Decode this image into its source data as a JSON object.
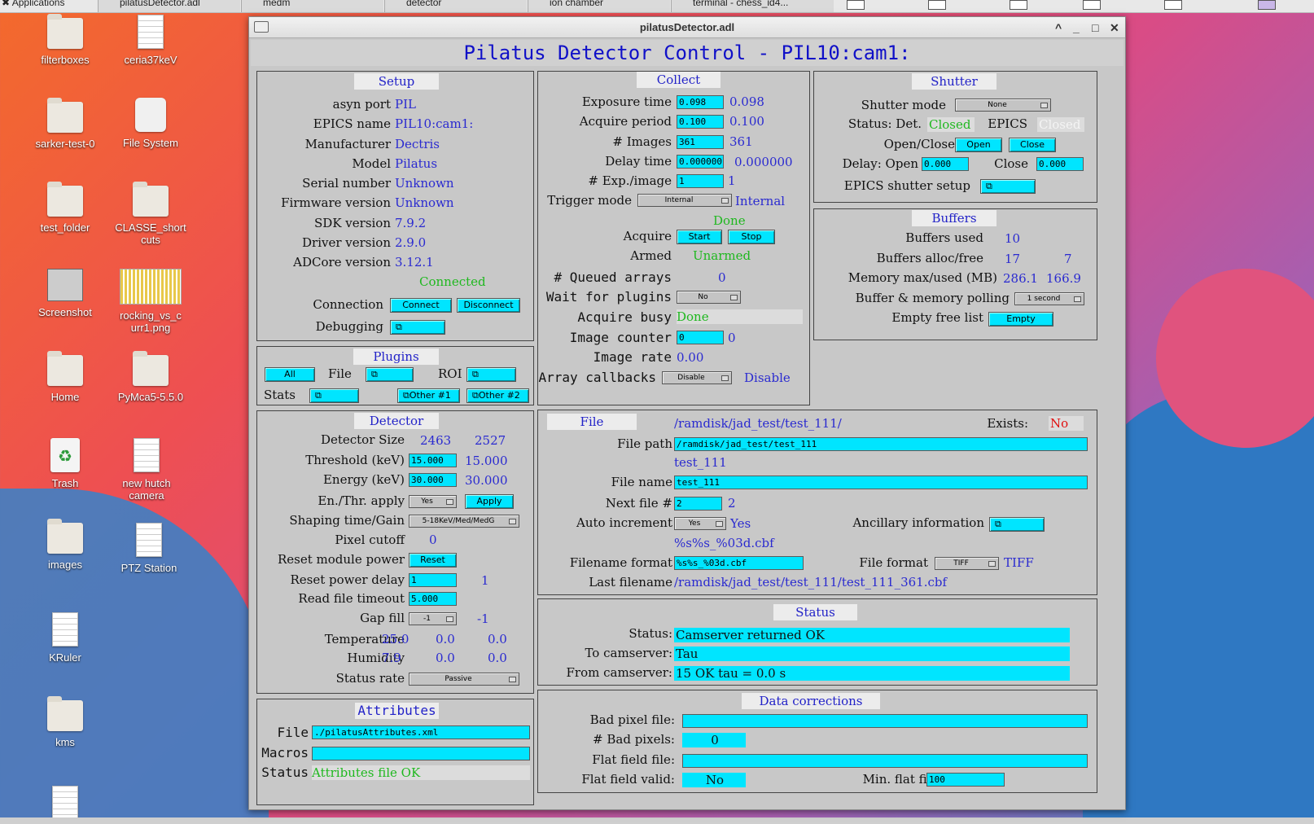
{
  "taskbar": {
    "apps": "Applications",
    "tabs": [
      "pilatusDetector.adl",
      "medm",
      "detector",
      "ion chamber",
      "terminal - chess_id4..."
    ]
  },
  "desktop": {
    "icons": [
      "filterboxes",
      "ceria37keV",
      "sarker-test-0",
      "File System",
      "test_folder",
      "CLASSE_short cuts",
      "Screenshot",
      "rocking_vs_c urr1.png",
      "Home",
      "PyMca5-5.5.0",
      "Trash",
      "new hutch camera",
      "images",
      "PTZ Station",
      "KRuler",
      "kms"
    ]
  },
  "window": {
    "title": "pilatusDetector.adl",
    "controls": [
      "^",
      "_",
      "□",
      "✕"
    ]
  },
  "main_title": "Pilatus Detector Control - PIL10:cam1:",
  "setup": {
    "title": "Setup",
    "rows": [
      {
        "label": "asyn port",
        "value": "PIL"
      },
      {
        "label": "EPICS name",
        "value": "PIL10:cam1:"
      },
      {
        "label": "Manufacturer",
        "value": "Dectris"
      },
      {
        "label": "Model",
        "value": "Pilatus"
      },
      {
        "label": "Serial number",
        "value": "Unknown"
      },
      {
        "label": "Firmware version",
        "value": "Unknown"
      },
      {
        "label": "SDK version",
        "value": "7.9.2"
      },
      {
        "label": "Driver version",
        "value": "2.9.0"
      },
      {
        "label": "ADCore version",
        "value": "3.12.1"
      }
    ],
    "connected": "Connected",
    "connection_label": "Connection",
    "connect": "Connect",
    "disconnect": "Disconnect",
    "debugging_label": "Debugging"
  },
  "plugins": {
    "title": "Plugins",
    "all": "All",
    "file": "File",
    "roi": "ROI",
    "stats": "Stats",
    "other1": "Other #1",
    "other2": "Other #2"
  },
  "detector": {
    "title": "Detector",
    "size_label": "Detector Size",
    "size_x": "2463",
    "size_y": "2527",
    "threshold_label": "Threshold (keV)",
    "threshold_in": "15.000",
    "threshold_rbv": "15.000",
    "energy_label": "Energy (keV)",
    "energy_in": "30.000",
    "energy_rbv": "30.000",
    "apply_label": "En./Thr. apply",
    "apply_menu": "Yes",
    "apply_btn": "Apply",
    "shaping_label": "Shaping time/Gain",
    "shaping_menu": "5-18KeV/Med/MedG",
    "cutoff_label": "Pixel cutoff",
    "cutoff": "0",
    "reset_label": "Reset module power",
    "reset_btn": "Reset",
    "delay_label": "Reset power delay",
    "delay_in": "1",
    "delay_rbv": "1",
    "timeout_label": "Read file timeout",
    "timeout_in": "5.000",
    "gap_label": "Gap fill",
    "gap_menu": "-1",
    "gap_rbv": "-1",
    "temp_label": "Temperature",
    "temp": [
      "25.0",
      "0.0",
      "0.0"
    ],
    "hum_label": "Humidity",
    "hum": [
      "7.9",
      "0.0",
      "0.0"
    ],
    "rate_label": "Status rate",
    "rate_menu": "Passive"
  },
  "attributes": {
    "title": "Attributes",
    "file_label": "File",
    "file": "./pilatusAttributes.xml",
    "macros_label": "Macros",
    "macros": "",
    "status_label": "Status",
    "status": "Attributes file OK"
  },
  "collect": {
    "title": "Collect",
    "rows": [
      {
        "label": "Exposure time",
        "in": "0.098",
        "rbv": "0.098"
      },
      {
        "label": "Acquire period",
        "in": "0.100",
        "rbv": "0.100"
      },
      {
        "label": "# Images",
        "in": "361",
        "rbv": "361"
      },
      {
        "label": "Delay time",
        "in": "0.000000",
        "rbv": "0.000000"
      },
      {
        "label": "# Exp./image",
        "in": "1",
        "rbv": "1"
      }
    ],
    "trigger_label": "Trigger mode",
    "trigger_menu": "Internal",
    "trigger_rbv": "Internal",
    "done": "Done",
    "acquire_label": "Acquire",
    "start": "Start",
    "stop": "Stop",
    "armed_label": "Armed",
    "armed": "Unarmed",
    "queued_label": "# Queued arrays",
    "queued": "0",
    "wait_label": "Wait for plugins",
    "wait_menu": "No",
    "busy_label": "Acquire busy",
    "busy": "Done",
    "counter_label": "Image counter",
    "counter_in": "0",
    "counter_rbv": "0",
    "rate_label": "Image rate",
    "rate": "0.00",
    "callbacks_label": "Array callbacks",
    "callbacks_menu": "Disable",
    "callbacks_rbv": "Disable"
  },
  "shutter": {
    "title": "Shutter",
    "mode_label": "Shutter mode",
    "mode_menu": "None",
    "status_label": "Status: Det.",
    "det": "Closed",
    "epics_label": "EPICS",
    "epics": "Closed",
    "oc_label": "Open/Close",
    "open": "Open",
    "close": "Close",
    "delay_label": "Delay: Open",
    "delay_open": "0.000",
    "close_label": "Close",
    "delay_close": "0.000",
    "setup_label": "EPICS shutter setup"
  },
  "buffers": {
    "title": "Buffers",
    "used_label": "Buffers used",
    "used": "10",
    "alloc_label": "Buffers alloc/free",
    "alloc": "17",
    "free": "7",
    "mem_label": "Memory max/used (MB)",
    "mem_max": "286.1",
    "mem_used": "166.9",
    "poll_label": "Buffer & memory polling",
    "poll_menu": "1 second",
    "empty_label": "Empty free list",
    "empty": "Empty"
  },
  "file": {
    "title": "File",
    "path_rbv": "/ramdisk/jad_test/test_111/",
    "exists_label": "Exists:",
    "exists": "No",
    "path_label": "File path",
    "path": "/ramdisk/jad_test/test_111",
    "name_rbv": "test_111",
    "name_label": "File name",
    "name": "test_111",
    "next_label": "Next file #",
    "next_in": "2",
    "next_rbv": "2",
    "auto_label": "Auto increment",
    "auto_menu": "Yes",
    "auto_rbv": "Yes",
    "anc_label": "Ancillary information",
    "format_rbv": "%s%s_%03d.cbf",
    "format_label": "Filename format",
    "format": "%s%s_%03d.cbf",
    "ff_label": "File format",
    "ff_menu": "TIFF",
    "ff_rbv": "TIFF",
    "last_label": "Last filename",
    "last": "/ramdisk/jad_test/test_111/test_111_361.cbf"
  },
  "status": {
    "title": "Status",
    "status_label": "Status:",
    "status": "Camserver returned OK",
    "to_label": "To camserver:",
    "to": "Tau",
    "from_label": "From camserver:",
    "from": "15 OK tau = 0.0 s"
  },
  "corr": {
    "title": "Data corrections",
    "bad_label": "Bad pixel file:",
    "bad": "",
    "nbad_label": "# Bad pixels:",
    "nbad": "0",
    "flat_label": "Flat field file:",
    "flat": "",
    "valid_label": "Flat field valid:",
    "valid": "No",
    "min_label": "Min. flat field:",
    "min": "100"
  },
  "colors": {
    "cyan": "#00e5ff",
    "blue_text": "#2a2ad0",
    "green_text": "#1fb81f",
    "red_text": "#e01010",
    "panel": "#c8c8c8"
  }
}
